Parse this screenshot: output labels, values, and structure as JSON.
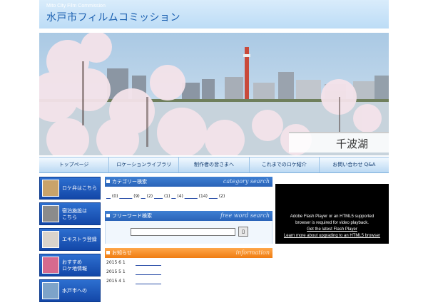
{
  "header": {
    "subtitle": "Mito City Film Commission",
    "title": "水戸市フィルムコミッション"
  },
  "hero": {
    "caption": "千波湖"
  },
  "nav": {
    "items": [
      "トップページ",
      "ロケーションライブラリ",
      "制作者の皆さまへ",
      "これまでのロケ紹介",
      "お問い合わせ Q&A"
    ]
  },
  "sidebar": {
    "items": [
      "ロケ弁はこちら",
      "宿泊施設は\nこちら",
      "エキストラ登録",
      "おすすめ\nロケ地情報",
      "水戸市への"
    ]
  },
  "category": {
    "heading": "カテゴリー検索",
    "heading_en": "category search",
    "counts": [
      "(0)",
      "(9)",
      "(2)",
      "(1)",
      "(4)",
      "(14)",
      "(2)"
    ]
  },
  "freeword": {
    "heading": "フリーワード検索",
    "heading_en": "free word search",
    "button_label": "⎕"
  },
  "news": {
    "heading": "お知らせ",
    "heading_en": "information",
    "dates": [
      "2015 6 1",
      "2015 5 1",
      "2015 4 1"
    ]
  },
  "flash": {
    "line1": "Adobe Flash Player or an HTML5 supported",
    "line2": "browser is required for video playback.",
    "link1": "Get the latest Flash Player",
    "link2": "Learn more about upgrading to an HTML5 browser"
  },
  "colors": {
    "primary_blue": "#2a63b8",
    "orange": "#ef7c12",
    "nav_text": "#113a6e"
  }
}
